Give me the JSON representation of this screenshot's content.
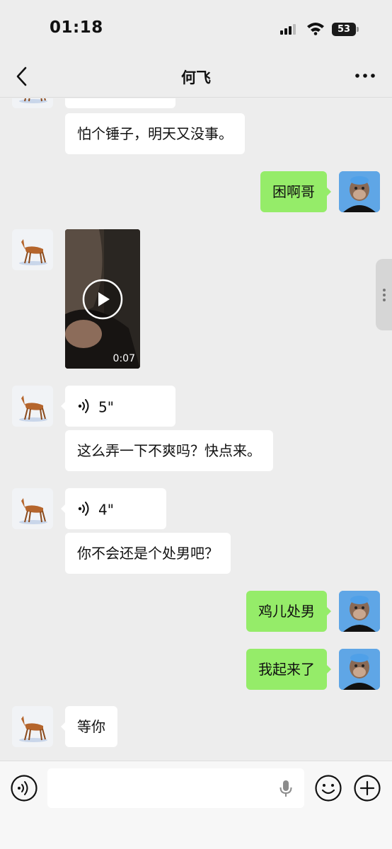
{
  "status_bar": {
    "time": "01:18",
    "battery": "53"
  },
  "header": {
    "title": "何飞"
  },
  "messages": [
    {
      "side": "left",
      "type": "text",
      "text": ""
    },
    {
      "side": "left",
      "type": "text",
      "text": "怕个锤子，明天又没事。"
    },
    {
      "side": "right",
      "type": "text",
      "text": "困啊哥"
    },
    {
      "side": "left",
      "type": "video",
      "duration": "0:07"
    },
    {
      "side": "left",
      "type": "voice",
      "duration": "5\""
    },
    {
      "side": "left",
      "type": "text",
      "text": "这么弄一下不爽吗？快点来。"
    },
    {
      "side": "left",
      "type": "voice",
      "duration": "4\""
    },
    {
      "side": "left",
      "type": "text",
      "text": "你不会还是个处男吧？"
    },
    {
      "side": "right",
      "type": "text",
      "text": "鸡儿处男"
    },
    {
      "side": "right",
      "type": "text",
      "text": "我起来了"
    },
    {
      "side": "left",
      "type": "text",
      "text": "等你"
    }
  ],
  "avatars": {
    "contact": "deer-avatar",
    "self": "cartoon-ape-avatar"
  },
  "input": {
    "placeholder": ""
  },
  "colors": {
    "background": "#ededed",
    "sent_bubble": "#95ec69",
    "received_bubble": "#ffffff"
  }
}
